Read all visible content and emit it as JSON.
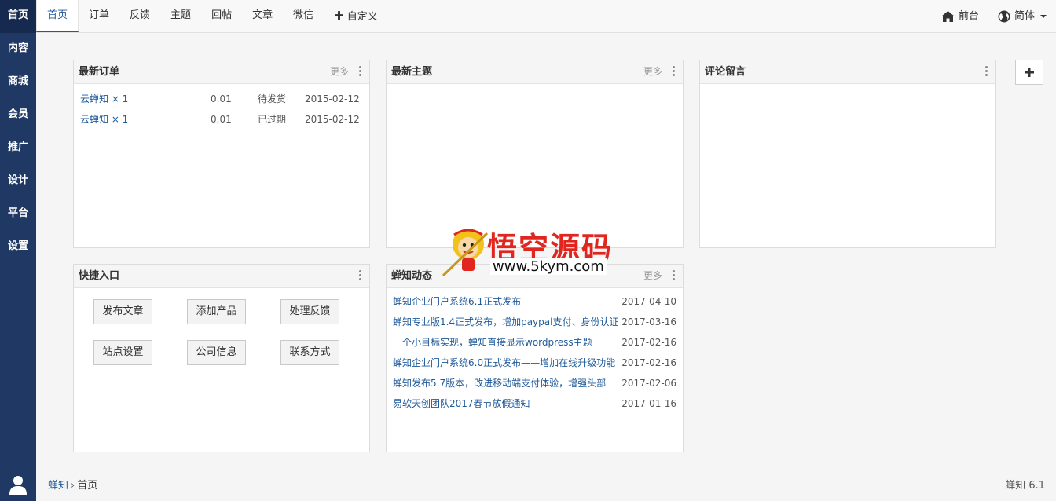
{
  "leftnav": {
    "items": [
      {
        "label": "首页"
      },
      {
        "label": "内容"
      },
      {
        "label": "商城"
      },
      {
        "label": "会员"
      },
      {
        "label": "推广"
      },
      {
        "label": "设计"
      },
      {
        "label": "平台"
      },
      {
        "label": "设置"
      }
    ]
  },
  "topbar": {
    "tabs": [
      {
        "label": "首页"
      },
      {
        "label": "订单"
      },
      {
        "label": "反馈"
      },
      {
        "label": "主题"
      },
      {
        "label": "回帖"
      },
      {
        "label": "文章"
      },
      {
        "label": "微信"
      },
      {
        "label": "自定义"
      }
    ],
    "frontend_label": "前台",
    "language_label": "简体"
  },
  "panels": {
    "orders": {
      "title": "最新订单",
      "more": "更多",
      "rows": [
        {
          "product": "云蝉知 × 1",
          "amount": "0.01",
          "status": "待发货",
          "date": "2015-02-12"
        },
        {
          "product": "云蝉知 × 1",
          "amount": "0.01",
          "status": "已过期",
          "date": "2015-02-12"
        }
      ]
    },
    "threads": {
      "title": "最新主题",
      "more": "更多"
    },
    "comments": {
      "title": "评论留言"
    },
    "quick": {
      "title": "快捷入口",
      "buttons": [
        {
          "label": "发布文章"
        },
        {
          "label": "添加产品"
        },
        {
          "label": "处理反馈"
        },
        {
          "label": "站点设置"
        },
        {
          "label": "公司信息"
        },
        {
          "label": "联系方式"
        }
      ]
    },
    "news": {
      "title": "蝉知动态",
      "more": "更多",
      "items": [
        {
          "title": "蝉知企业门户系统6.1正式发布",
          "date": "2017-04-10"
        },
        {
          "title": "蝉知专业版1.4正式发布，增加paypal支付、身份认证",
          "date": "2017-03-16"
        },
        {
          "title": "一个小目标实现，蝉知直接显示wordpress主题",
          "date": "2017-02-16"
        },
        {
          "title": "蝉知企业门户系统6.0正式发布——增加在线升级功能",
          "date": "2017-02-16"
        },
        {
          "title": "蝉知发布5.7版本，改进移动端支付体验，增强头部",
          "date": "2017-02-06"
        },
        {
          "title": "易软天创团队2017春节放假通知",
          "date": "2017-01-16"
        }
      ]
    }
  },
  "watermark": {
    "title": "悟空源码",
    "url": "www.5kym.com"
  },
  "footer": {
    "breadcrumb": [
      {
        "label": "蝉知"
      },
      {
        "label": "首页"
      }
    ],
    "version": "蝉知 6.1"
  },
  "colors": {
    "sidebar": "#1f3864",
    "link": "#1f5a9a",
    "watermark": "#e0261f"
  },
  "icons": [
    "home-icon",
    "globe-icon",
    "plus-icon",
    "user-icon",
    "kebab-icon",
    "monkey-logo"
  ]
}
